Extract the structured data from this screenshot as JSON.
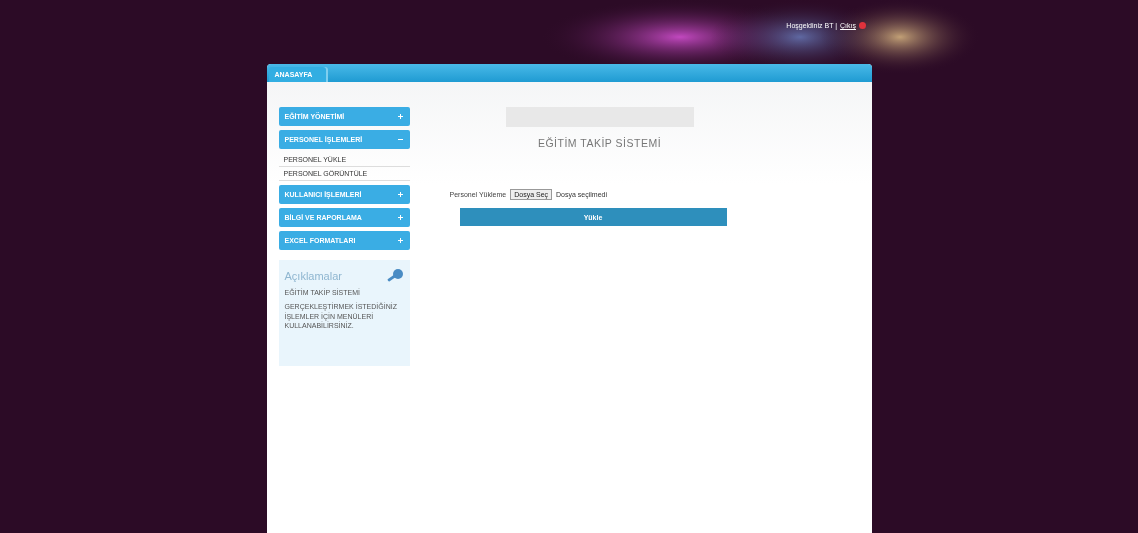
{
  "header": {
    "welcome": "Hoşgeldiniz BT |",
    "logout": "Çıkış"
  },
  "tabs": [
    {
      "label": "ANASAYFA",
      "selected": true
    }
  ],
  "menu": [
    {
      "label": "EĞİTİM YÖNETİMİ",
      "expanded": false
    },
    {
      "label": "PERSONEL İŞLEMLERİ",
      "expanded": true,
      "children": [
        {
          "label": "PERSONEL YÜKLE"
        },
        {
          "label": "PERSONEL GÖRÜNTÜLE"
        }
      ]
    },
    {
      "label": "KULLANICI İŞLEMLERİ",
      "expanded": false
    },
    {
      "label": "BİLGİ VE RAPORLAMA",
      "expanded": false
    },
    {
      "label": "EXCEL FORMATLARI",
      "expanded": false
    }
  ],
  "notes": {
    "title": "Açıklamalar",
    "lines": [
      "EĞİTİM TAKİP SİSTEMİ",
      "GERÇEKLEŞTİRMEK İSTEDİĞİNİZ İŞLEMLER İÇİN MENÜLERİ KULLANABİLİRSİNİZ."
    ]
  },
  "main": {
    "title": "EĞİTİM TAKİP SİSTEMİ",
    "file_label": "Personel Yükleme",
    "file_button": "Dosya Seç",
    "file_status": "Dosya seçilmedi",
    "upload_button": "Yükle"
  }
}
